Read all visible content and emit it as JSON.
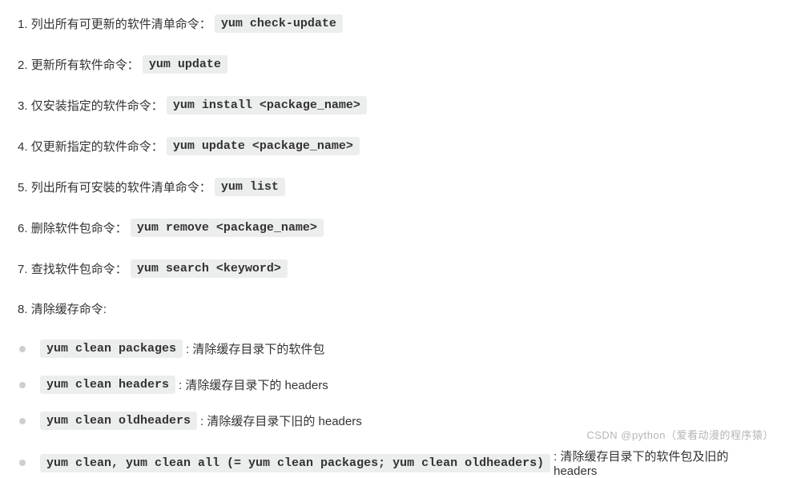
{
  "items": [
    {
      "num": "1.",
      "label": "列出所有可更新的软件清单命令：",
      "code": "yum check-update"
    },
    {
      "num": "2.",
      "label": "更新所有软件命令：",
      "code": "yum update"
    },
    {
      "num": "3.",
      "label": "仅安装指定的软件命令：",
      "code": "yum install <package_name>"
    },
    {
      "num": "4.",
      "label": "仅更新指定的软件命令：",
      "code": "yum update <package_name>"
    },
    {
      "num": "5.",
      "label": "列出所有可安裝的软件清单命令：",
      "code": "yum list"
    },
    {
      "num": "6.",
      "label": "删除软件包命令：",
      "code": "yum remove <package_name>"
    },
    {
      "num": "7.",
      "label": "查找软件包命令：",
      "code": "yum search <keyword>"
    }
  ],
  "clear_header": {
    "num": "8.",
    "label": "清除缓存命令:"
  },
  "clear": [
    {
      "code": "yum clean packages",
      "desc": ": 清除缓存目录下的软件包"
    },
    {
      "code": "yum clean headers",
      "desc": ": 清除缓存目录下的 headers"
    },
    {
      "code": "yum clean oldheaders",
      "desc": ": 清除缓存目录下旧的 headers"
    },
    {
      "code": "yum clean, yum clean all (= yum clean packages; yum clean oldheaders)",
      "desc": ": 清除缓存目录下的软件包及旧的 headers"
    }
  ],
  "watermark": "CSDN @python（爱看动漫的程序猿）"
}
